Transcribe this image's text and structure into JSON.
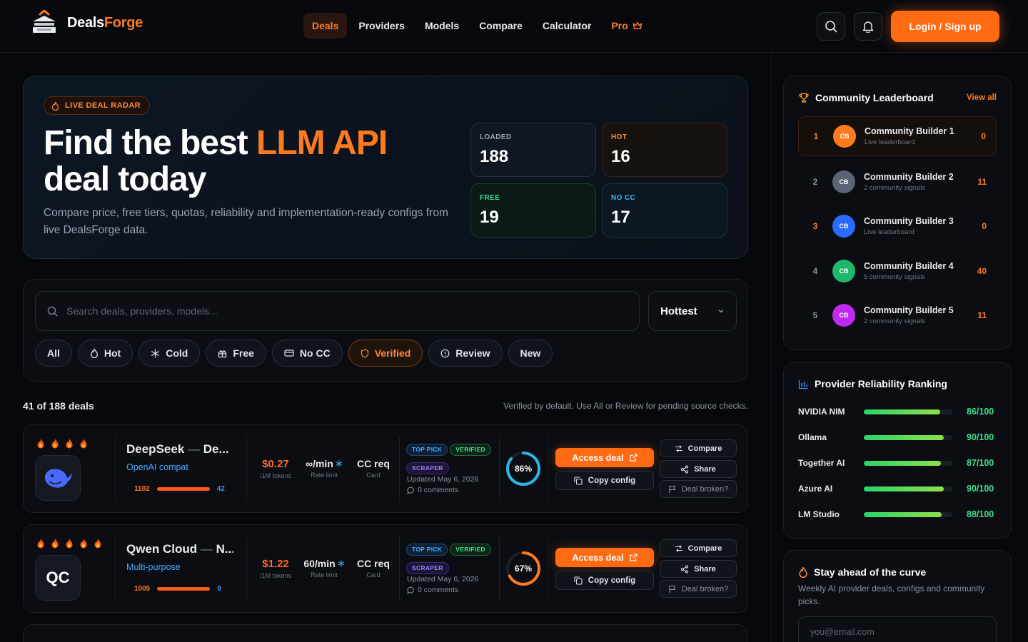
{
  "brand": {
    "name_white": "Deals",
    "name_orange": "Forge"
  },
  "nav": {
    "items": [
      {
        "label": "Deals",
        "active": true
      },
      {
        "label": "Providers"
      },
      {
        "label": "Models"
      },
      {
        "label": "Compare"
      },
      {
        "label": "Calculator"
      }
    ],
    "pro_label": "Pro"
  },
  "header": {
    "login_label": "Login / Sign up"
  },
  "hero": {
    "badge": "LIVE DEAL RADAR",
    "title_line1_a": "Find the best ",
    "title_line1_accent": "LLM API",
    "title_line2": "deal today",
    "subtitle": "Compare price, free tiers, quotas, reliability and implementation-ready configs from live DealsForge data.",
    "stats": [
      {
        "label": "LOADED",
        "value": "188"
      },
      {
        "label": "HOT",
        "value": "16"
      },
      {
        "label": "FREE",
        "value": "19"
      },
      {
        "label": "NO CC",
        "value": "17"
      }
    ]
  },
  "filters": {
    "search_placeholder": "Search deals, providers, models...",
    "sort_value": "Hottest",
    "chips": [
      "All",
      "Hot",
      "Cold",
      "Free",
      "No CC",
      "Verified",
      "Review",
      "New"
    ],
    "active_chip": "Verified"
  },
  "results": {
    "count": "41 of 188 deals",
    "note": "Verified by default. Use All or Review for pending source checks."
  },
  "deals": [
    {
      "provider": "DeepSeek",
      "model": "De...",
      "subtitle": "OpenAI compat",
      "flames": 4,
      "upvotes": "1102",
      "downvotes": "42",
      "price": "$0.27",
      "price_unit": "/1M tokens",
      "rate": "∞/min",
      "rate_label": "Rate limit",
      "card": "CC req",
      "card_label": "Card",
      "tags": [
        "TOP PICK",
        "VERIFIED",
        "SCRAPER"
      ],
      "updated": "Updated May 6, 2026",
      "comments": "0 comments",
      "reliability": 86,
      "reliability_label": "86%",
      "ring_color": "#2ab8e8",
      "access_label": "Access deal",
      "copy_label": "Copy config",
      "compare_label": "Compare",
      "share_label": "Share",
      "broken_label": "Deal broken?"
    },
    {
      "provider": "Qwen Cloud",
      "model": "N...",
      "subtitle": "Multi-purpose",
      "logo_text": "QC",
      "flames": 5,
      "upvotes": "1005",
      "downvotes": "9",
      "price": "$1.22",
      "price_unit": "/1M tokens",
      "rate": "60/min",
      "rate_label": "Rate limit",
      "card": "CC req",
      "card_label": "Card",
      "tags": [
        "TOP PICK",
        "VERIFIED",
        "SCRAPER"
      ],
      "updated": "Updated May 6, 2026",
      "comments": "0 comments",
      "reliability": 67,
      "reliability_label": "67%",
      "ring_color": "#ff7a1f",
      "access_label": "Access deal",
      "copy_label": "Copy config",
      "compare_label": "Compare",
      "share_label": "Share",
      "broken_label": "Deal broken?"
    }
  ],
  "leaderboard": {
    "title": "Community Leaderboard",
    "view_all": "View all",
    "entries": [
      {
        "rank": "1",
        "initials": "CB",
        "name": "Community Builder 1",
        "meta": "Live leaderboard",
        "score": "0",
        "color": "#ff7a1f"
      },
      {
        "rank": "2",
        "initials": "CB",
        "name": "Community Builder 2",
        "meta": "2 community signals",
        "score": "11",
        "color": "#5a6474"
      },
      {
        "rank": "3",
        "initials": "CB",
        "name": "Community Builder 3",
        "meta": "Live leaderboard",
        "score": "0",
        "color": "#2a6aff"
      },
      {
        "rank": "4",
        "initials": "CB",
        "name": "Community Builder 4",
        "meta": "5 community signals",
        "score": "40",
        "color": "#1fb86a"
      },
      {
        "rank": "5",
        "initials": "CB",
        "name": "Community Builder 5",
        "meta": "2 community signals",
        "score": "11",
        "color": "#c02af0"
      }
    ]
  },
  "reliability": {
    "title": "Provider Reliability Ranking",
    "rows": [
      {
        "name": "NVIDIA NIM",
        "score": 86,
        "label": "86/100"
      },
      {
        "name": "Ollama",
        "score": 90,
        "label": "90/100"
      },
      {
        "name": "Together AI",
        "score": 87,
        "label": "87/100"
      },
      {
        "name": "Azure AI",
        "score": 90,
        "label": "90/100"
      },
      {
        "name": "LM Studio",
        "score": 88,
        "label": "88/100"
      }
    ]
  },
  "newsletter": {
    "title": "Stay ahead of the curve",
    "subtitle": "Weekly AI provider deals, configs and community picks.",
    "placeholder": "you@email.com"
  }
}
